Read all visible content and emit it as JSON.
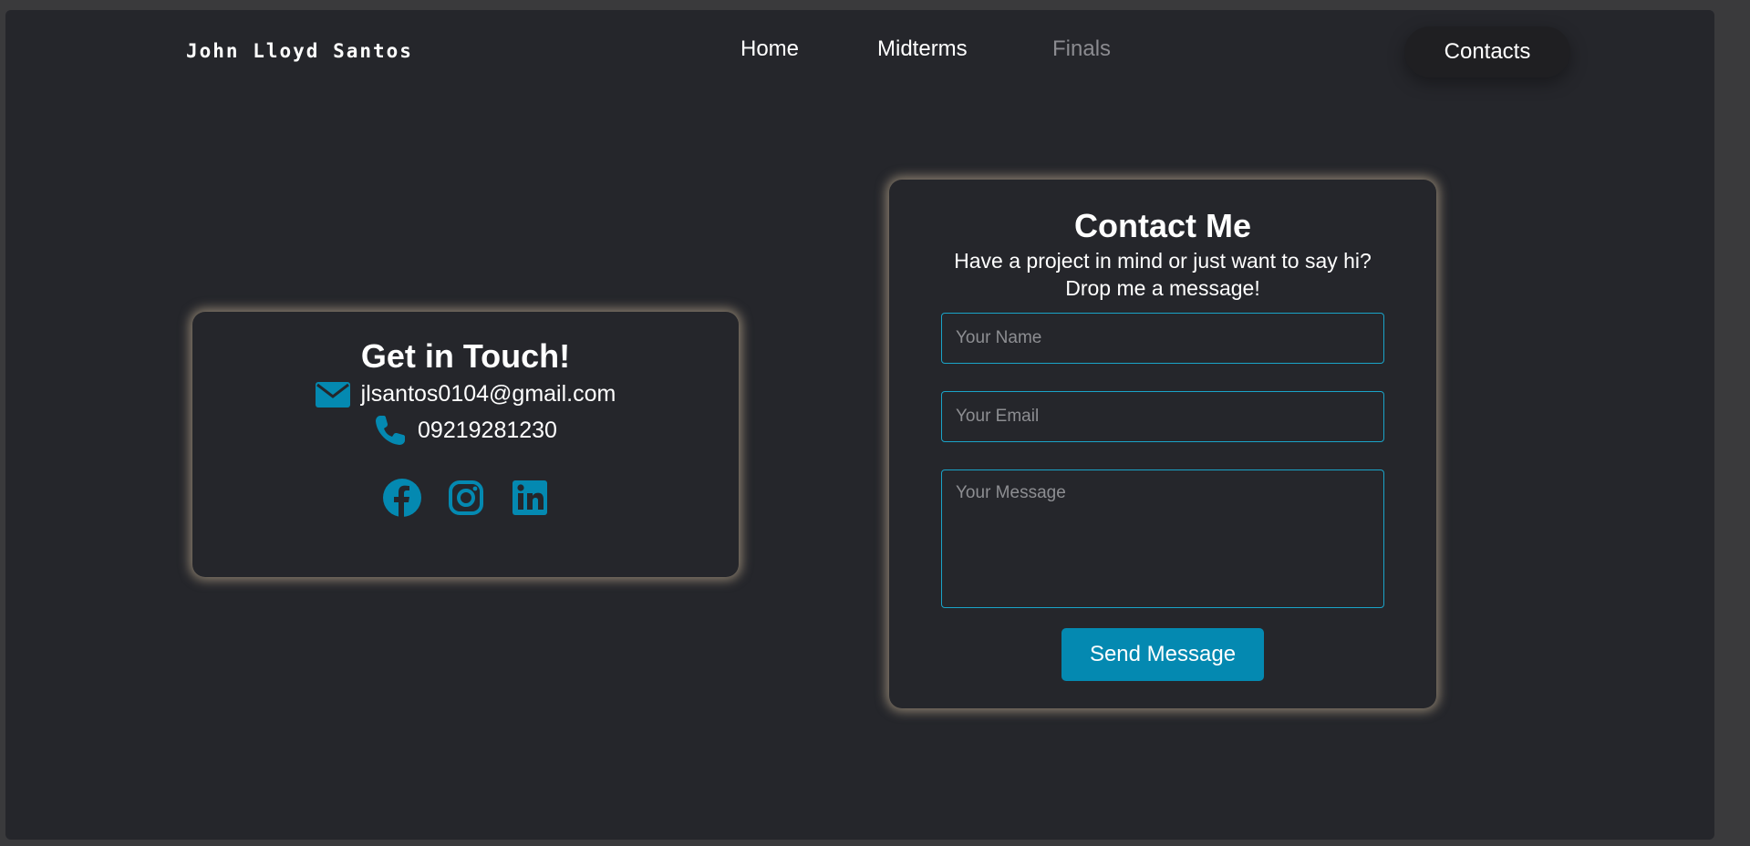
{
  "header": {
    "brand": "John Lloyd Santos",
    "nav": {
      "home": "Home",
      "midterms": "Midterms",
      "finals": "Finals",
      "contacts": "Contacts"
    }
  },
  "get_in_touch": {
    "title": "Get in Touch!",
    "email": "jlsantos0104@gmail.com",
    "phone": "09219281230",
    "socials": [
      "facebook-icon",
      "instagram-icon",
      "linkedin-icon"
    ]
  },
  "contact_form": {
    "title": "Contact Me",
    "subtitle_line1": "Have a project in mind or just want to say hi?",
    "subtitle_line2": "Drop me a message!",
    "name_placeholder": "Your Name",
    "email_placeholder": "Your Email",
    "message_placeholder": "Your Message",
    "send_label": "Send Message"
  },
  "colors": {
    "background": "#25262b",
    "accent": "#0489b1",
    "glow": "#e6cdaa",
    "text": "#ffffff",
    "nav_dim": "#8b8b90"
  }
}
